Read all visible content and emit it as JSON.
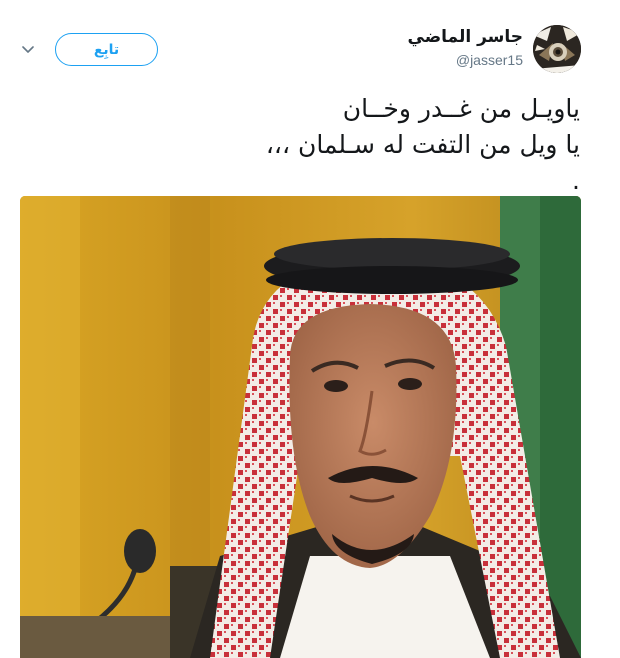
{
  "tweet": {
    "author": {
      "name": "جاسر الماضي",
      "handle": "@jasser15"
    },
    "follow_label": "تابِع",
    "text_lines": [
      "ياويـل من غــدر وخــان",
      "يا ويل من التفت له سـلمان ،،،",
      "."
    ]
  }
}
